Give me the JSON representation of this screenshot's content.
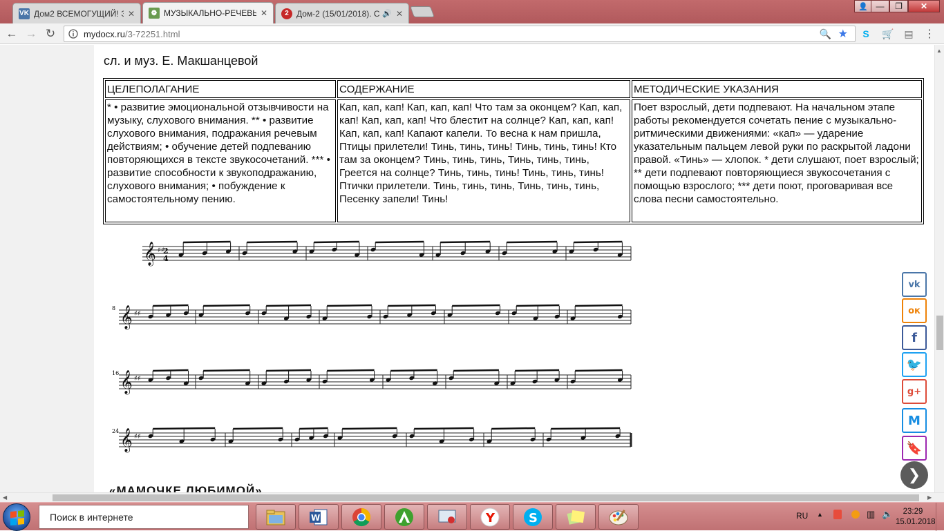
{
  "browser": {
    "tabs": [
      {
        "title": "Дом2 ВСЕМОГУЩИЙ! Э",
        "favicon": "vk-icon",
        "active": false
      },
      {
        "title": "МУЗЫКАЛЬНО-РЕЧЕВЫ",
        "favicon": "mydocx-icon",
        "active": true
      },
      {
        "title": "Дом-2 (15/01/2018). С",
        "favicon": "dom2-icon",
        "active": false
      }
    ],
    "url_host": "mydocx.ru",
    "url_path": "/3-72251.html"
  },
  "page": {
    "heading": "сл. и муз. Е. Макшанцевой",
    "table": {
      "headers": [
        "ЦЕЛЕПОЛАГАНИЕ",
        "СОДЕРЖАНИЕ",
        "МЕТОДИЧЕСКИЕ УКАЗАНИЯ"
      ],
      "row": [
        "* • развитие эмоциональной отзывчивости на музыку, слухового внимания. ** • развитие слухового внимания, подражания речевым действиям; • обучение детей подпеванию повторяющихся в тексте звукосочетаний. *** • развитие способности к звукоподражанию, слухового внимания; • побуждение к самостоятельному пению.",
        "Кап, кап, кап! Кап, кап, кап! Что там за оконцем? Кап, кап, кап! Кап, кап, кап! Что блестит на солнце?   Кап, кап, кап! Кап, кап, кап! Капают капели. То весна к нам пришла, Птицы прилетели!   Тинь, тинь, тинь! Тинь, тинь, тинь! Кто там за оконцем? Тинь, тинь, тинь, Тинь, тинь, тинь, Греется на солнце?   Тинь, тинь, тинь! Тинь, тинь, тинь! Птички прилетели. Тинь, тинь, тинь, Тинь, тинь, тинь, Песенку запели! Тинь!",
        "Поет взрослый, дети подпевают. На начальном этапе работы рекомендуется сочетать пение с музыкально-ритмическими движениями: «кап» — ударение указательным пальцем левой руки по раскрытой ладони правой.     «Тинь» — хлопок.   * дети слушают, поет взрослый; ** дети подпевают повторяющиеся звукосочетания с помощью взрослого; *** дети поют, проговаривая все слова песни самостоятельно."
      ]
    },
    "score": {
      "time_signature": [
        "2",
        "4"
      ],
      "measure_numbers": [
        "8",
        "16",
        "24"
      ]
    },
    "next_heading": "«МАМОЧКЕ ЛЮБИМОЙ»"
  },
  "share": [
    {
      "name": "vk-share-icon",
      "label": "vk",
      "color": "#4a76a8"
    },
    {
      "name": "odnoklassniki-share-icon",
      "label": "ok",
      "color": "#ee8208"
    },
    {
      "name": "facebook-share-icon",
      "label": "f",
      "color": "#3b5998"
    },
    {
      "name": "twitter-share-icon",
      "label": "t",
      "color": "#1da1f2"
    },
    {
      "name": "googleplus-share-icon",
      "label": "g+",
      "color": "#dd4b39"
    },
    {
      "name": "moimir-share-icon",
      "label": "M",
      "color": "#168de2"
    },
    {
      "name": "bookmark-share-icon",
      "label": "b",
      "color": "#9c27b0"
    }
  ],
  "taskbar": {
    "search_placeholder": "Поиск в интернете",
    "language": "RU",
    "time": "23:29",
    "date": "15.01.2018"
  }
}
